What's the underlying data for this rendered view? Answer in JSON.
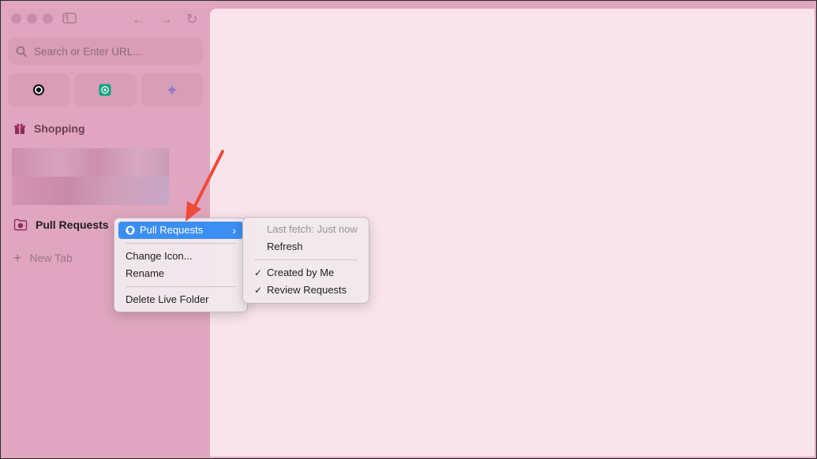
{
  "toolbar": {
    "back_icon": "←",
    "forward_icon": "→",
    "reload_icon": "↻"
  },
  "urlbar": {
    "placeholder": "Search or Enter URL..."
  },
  "sidebar": {
    "shopping_label": "Shopping",
    "pull_requests_label": "Pull Requests",
    "new_tab_label": "New Tab"
  },
  "context_menu": {
    "items": [
      "Pull Requests",
      "Change Icon...",
      "Rename",
      "Delete Live Folder"
    ],
    "chevron": "›"
  },
  "submenu": {
    "status": "Last fetch: Just now",
    "refresh": "Refresh",
    "created_by_me": "Created by Me",
    "review_requests": "Review Requests",
    "check_glyph": "✓"
  },
  "colors": {
    "accent": "#3b8ff3",
    "arrow": "#f0493a"
  }
}
